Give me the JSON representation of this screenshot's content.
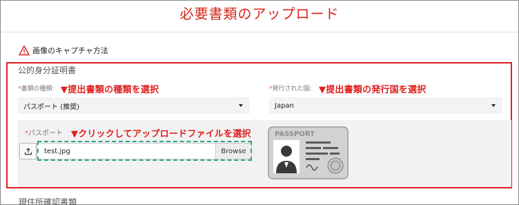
{
  "page": {
    "title": "必要書類のアップロード",
    "capture_link": "画像のキャプチャ方法"
  },
  "identity": {
    "section_title": "公的身分証明書",
    "doc_type": {
      "label": "書類の種類:",
      "annotation": "▼提出書類の種類を選択",
      "value": "パスポート (推奨)"
    },
    "country": {
      "label": "発行された国:",
      "annotation": "▼提出書類の発行国を選択",
      "value": "Japan"
    },
    "passport": {
      "label": "パスポート",
      "annotation": "▼クリックしてアップロードファイルを選択",
      "file_value": "test.jpg",
      "browse_label": "Browse",
      "image_text": "PASSPORT"
    }
  },
  "next_section": {
    "title": "現住所確認書類"
  },
  "colors": {
    "accent_red": "#e01e1e",
    "title_red": "#d9241b",
    "dash_green": "#2aa57e"
  }
}
